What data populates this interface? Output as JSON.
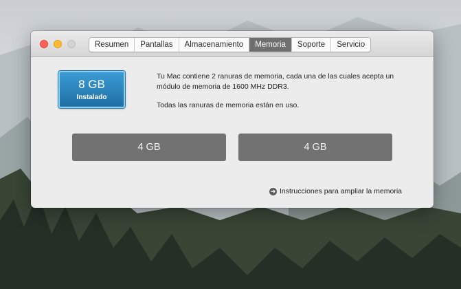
{
  "window": {
    "tabs": [
      {
        "label": "Resumen"
      },
      {
        "label": "Pantallas"
      },
      {
        "label": "Almacenamiento"
      },
      {
        "label": "Memoria",
        "active": true
      },
      {
        "label": "Soporte"
      },
      {
        "label": "Servicio"
      }
    ]
  },
  "memory": {
    "installed_size": "8 GB",
    "installed_label": "Instalado",
    "description_line1": "Tu Mac contiene 2 ranuras de memoria, cada una de las cuales acepta un módulo de memoria de 1600 MHz DDR3.",
    "description_line2": "Todas las ranuras de memoria están en uso.",
    "slots": [
      {
        "size": "4 GB"
      },
      {
        "size": "4 GB"
      }
    ],
    "help_link": "Instrucciones para ampliar la memoria",
    "help_icon": "arrow-circle-icon"
  },
  "colors": {
    "badge": "#1e6fa3",
    "active_tab": "#6f6f6f",
    "slot": "#727272",
    "close": "#fc5f57",
    "minimize": "#fdbc2e"
  }
}
